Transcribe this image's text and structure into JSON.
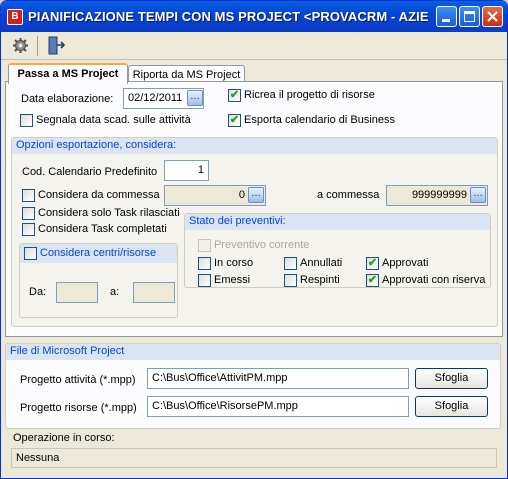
{
  "window": {
    "title": "PIANIFICAZIONE TEMPI CON MS PROJECT <PROVACRM - AZIENDA..."
  },
  "tabs": [
    {
      "label": "Passa a MS Project",
      "active": true
    },
    {
      "label": "Riporta da MS Project",
      "active": false
    }
  ],
  "export": {
    "data_label": "Data elaborazione:",
    "data_value": "02/12/2011",
    "ricrea_label": "Ricrea il progetto di risorse",
    "ricrea_checked": true,
    "segnala_label": "Segnala data scad. sulle attività",
    "segnala_checked": false,
    "esporta_label": "Esporta calendario di Business",
    "esporta_checked": true
  },
  "options": {
    "header": "Opzioni esportazione, considera:",
    "cal_label": "Cod. Calendario Predefinito",
    "cal_value": "1",
    "da_commessa_label": "Considera da commessa",
    "da_commessa_value": "0",
    "a_commessa_label": "a commessa",
    "a_commessa_value": "999999999",
    "solo_task_label": "Considera solo Task rilasciati",
    "task_completati_label": "Considera Task completati",
    "centri_label": "Considera centri/risorse",
    "da_label": "Da:",
    "a_label": "a:"
  },
  "stato": {
    "header": "Stato dei preventivi:",
    "corrente": "Preventivo corrente",
    "in_corso": "In corso",
    "annullati": "Annullati",
    "approvati": "Approvati",
    "emessi": "Emessi",
    "respinti": "Respinti",
    "approvati_riserva": "Approvati con riserva"
  },
  "files": {
    "header": "File di Microsoft Project",
    "attivita_label": "Progetto attività (*.mpp)",
    "attivita_value": "C:\\Bus\\Office\\AttivitPM.mpp",
    "risorse_label": "Progetto risorse (*.mpp)",
    "risorse_value": "C:\\Bus\\Office\\RisorsePM.mpp",
    "sfoglia": "Sfoglia"
  },
  "status": {
    "label": "Operazione in corso:",
    "value": "Nessuna"
  },
  "colors": {
    "titlebar": "#0346d8",
    "group_header": "#dbe4f3",
    "check": "#21a121"
  }
}
